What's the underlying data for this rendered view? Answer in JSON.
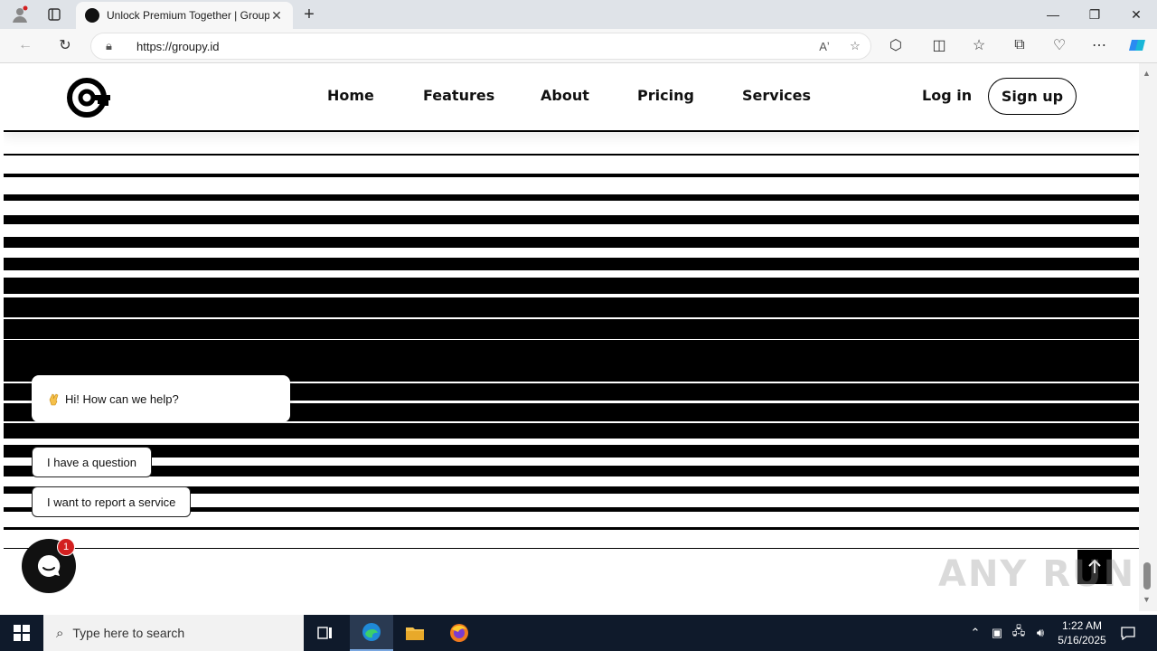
{
  "browser": {
    "tab_title": "Unlock Premium Together | Groupy",
    "url": "https://groupy.id",
    "new_tab_icon": "plus-icon",
    "icons": [
      "back-icon",
      "refresh-icon",
      "lock-icon",
      "read-aloud-icon",
      "favorite-star-icon",
      "extensions-icon",
      "split-screen-icon",
      "favorites-icon",
      "collections-icon",
      "browser-essentials-icon",
      "more-icon",
      "copilot-icon"
    ]
  },
  "site": {
    "nav": {
      "home": "Home",
      "features": "Features",
      "about": "About",
      "pricing": "Pricing",
      "services": "Services"
    },
    "login": "Log in",
    "signup": "Sign up"
  },
  "chat": {
    "greeting": "Hi! How can we help?",
    "option_question": "I have a question",
    "option_report": "I want to report a service",
    "badge_count": "1"
  },
  "watermark": "ANY RUN",
  "taskbar": {
    "search_placeholder": "Type here to search",
    "time": "1:22 AM",
    "date": "5/16/2025"
  },
  "colors": {
    "brand": "#000000",
    "badge": "#d32020",
    "taskbar": "#0f1a2b"
  }
}
